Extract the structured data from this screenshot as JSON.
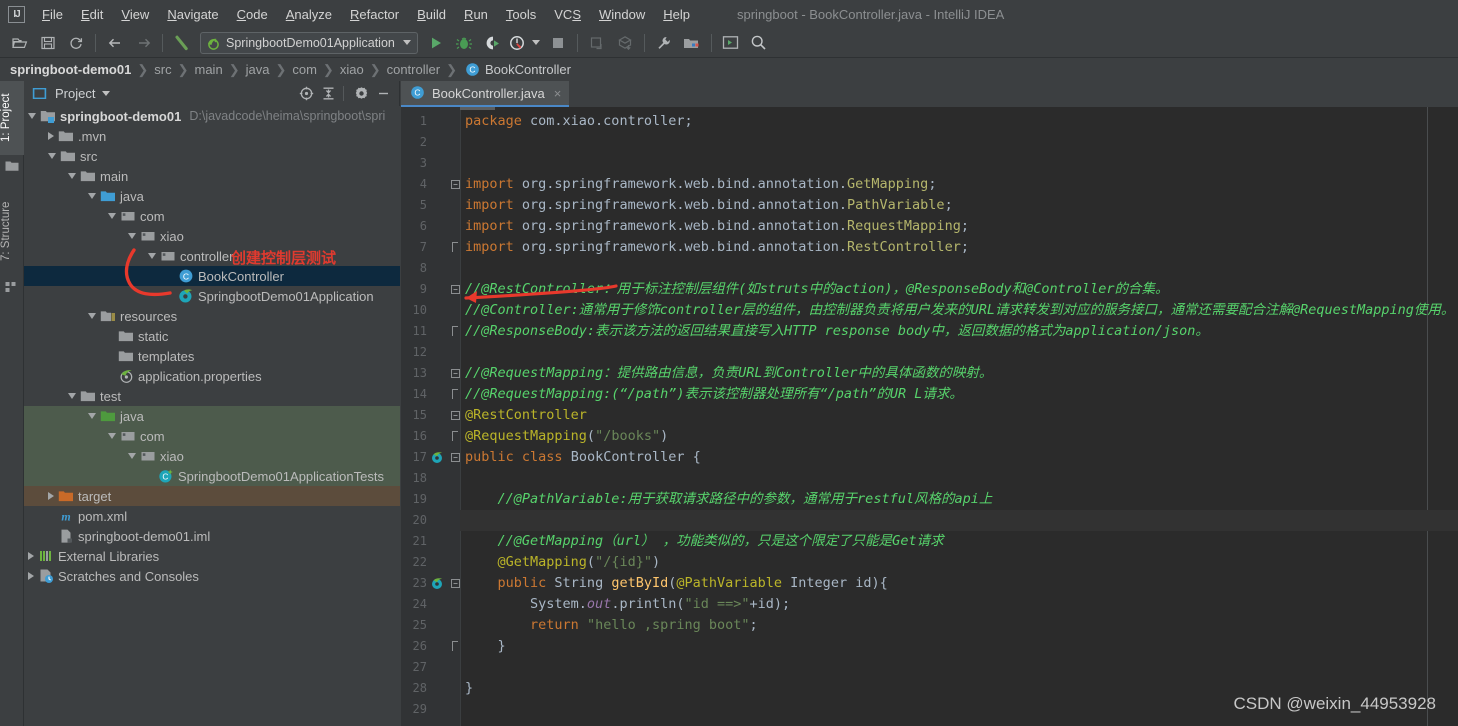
{
  "window": {
    "title": "springboot - BookController.java - IntelliJ IDEA",
    "logo": "IJ"
  },
  "menubar": {
    "items": [
      {
        "label": "File",
        "mnemonic": "F"
      },
      {
        "label": "Edit",
        "mnemonic": "E"
      },
      {
        "label": "View",
        "mnemonic": "V"
      },
      {
        "label": "Navigate",
        "mnemonic": "N"
      },
      {
        "label": "Code",
        "mnemonic": "C"
      },
      {
        "label": "Analyze",
        "mnemonic": "A"
      },
      {
        "label": "Refactor",
        "mnemonic": "R"
      },
      {
        "label": "Build",
        "mnemonic": "B"
      },
      {
        "label": "Run",
        "mnemonic": "R"
      },
      {
        "label": "Tools",
        "mnemonic": "T"
      },
      {
        "label": "VCS",
        "mnemonic": "S"
      },
      {
        "label": "Window",
        "mnemonic": "W"
      },
      {
        "label": "Help",
        "mnemonic": "H"
      }
    ]
  },
  "toolbar": {
    "run_config": "SpringbootDemo01Application",
    "icons": [
      "open-folder-icon",
      "save-all-icon",
      "sync-refresh-icon",
      "back-arrow-icon",
      "forward-arrow-icon",
      "build-hammer-icon",
      "run-icon",
      "debug-icon",
      "run-with-coverage-icon",
      "profiler-icon",
      "stop-icon",
      "update-project-icon",
      "push-commit-icon",
      "settings-wrench-icon",
      "project-structure-icon",
      "terminal-icon",
      "search-everywhere-icon"
    ]
  },
  "breadcrumb": {
    "root": "springboot-demo01",
    "segments": [
      "src",
      "main",
      "java",
      "com",
      "xiao",
      "controller"
    ],
    "leaf": "BookController",
    "leaf_icon": "class-icon"
  },
  "toolwindow_strip": {
    "tabs": [
      {
        "label": "1: Project",
        "active": true
      },
      {
        "label": "7: Structure",
        "active": false
      }
    ]
  },
  "project_panel": {
    "title": "Project",
    "header_icons": [
      "select-opened-file-icon",
      "collapse-all-icon",
      "gear-icon",
      "hide-icon"
    ],
    "tree": [
      {
        "depth": 0,
        "label": "springboot-demo01",
        "path": "D:\\javadcode\\heima\\springboot\\spri",
        "icon": "module-icon",
        "state": "expanded",
        "bold": true,
        "highlight": "none"
      },
      {
        "depth": 1,
        "label": ".mvn",
        "icon": "folder-icon",
        "state": "collapsed",
        "highlight": "none"
      },
      {
        "depth": 1,
        "label": "src",
        "icon": "folder-icon",
        "state": "expanded",
        "highlight": "none"
      },
      {
        "depth": 2,
        "label": "main",
        "icon": "folder-icon",
        "state": "expanded",
        "highlight": "none"
      },
      {
        "depth": 3,
        "label": "java",
        "icon": "source-root-icon",
        "state": "expanded",
        "highlight": "none"
      },
      {
        "depth": 4,
        "label": "com",
        "icon": "package-icon",
        "state": "expanded",
        "highlight": "none"
      },
      {
        "depth": 5,
        "label": "xiao",
        "icon": "package-icon",
        "state": "expanded",
        "highlight": "none"
      },
      {
        "depth": 6,
        "label": "controller",
        "icon": "package-icon",
        "state": "expanded",
        "highlight": "none"
      },
      {
        "depth": 7,
        "label": "BookController",
        "icon": "class-icon",
        "state": "leaf",
        "highlight": "selected"
      },
      {
        "depth": 7,
        "label": "SpringbootDemo01Application",
        "icon": "spring-class-icon",
        "state": "leaf",
        "highlight": "none"
      },
      {
        "depth": 3,
        "label": "resources",
        "icon": "resources-root-icon",
        "state": "expanded",
        "highlight": "none"
      },
      {
        "depth": 4,
        "label": "static",
        "icon": "folder-icon",
        "state": "leaf",
        "highlight": "none"
      },
      {
        "depth": 4,
        "label": "templates",
        "icon": "folder-icon",
        "state": "leaf",
        "highlight": "none"
      },
      {
        "depth": 4,
        "label": "application.properties",
        "icon": "spring-properties-icon",
        "state": "leaf",
        "highlight": "none"
      },
      {
        "depth": 2,
        "label": "test",
        "icon": "folder-icon",
        "state": "expanded",
        "highlight": "none"
      },
      {
        "depth": 3,
        "label": "java",
        "icon": "test-source-root-icon",
        "state": "expanded",
        "highlight": "green"
      },
      {
        "depth": 4,
        "label": "com",
        "icon": "package-icon",
        "state": "expanded",
        "highlight": "green"
      },
      {
        "depth": 5,
        "label": "xiao",
        "icon": "package-icon",
        "state": "expanded",
        "highlight": "green"
      },
      {
        "depth": 6,
        "label": "SpringbootDemo01ApplicationTests",
        "icon": "test-class-icon",
        "state": "leaf",
        "highlight": "green"
      },
      {
        "depth": 1,
        "label": "target",
        "icon": "excluded-folder-icon",
        "state": "collapsed",
        "highlight": "brown"
      },
      {
        "depth": 1,
        "label": "pom.xml",
        "icon": "maven-icon",
        "state": "leaf",
        "highlight": "none"
      },
      {
        "depth": 1,
        "label": "springboot-demo01.iml",
        "icon": "iml-file-icon",
        "state": "leaf",
        "highlight": "none"
      },
      {
        "depth": 0,
        "label": "External Libraries",
        "icon": "libraries-icon",
        "state": "collapsed",
        "highlight": "none"
      },
      {
        "depth": 0,
        "label": "Scratches and Consoles",
        "icon": "scratches-icon",
        "state": "collapsed",
        "highlight": "none"
      }
    ]
  },
  "editor": {
    "tab": {
      "label": "BookController.java",
      "icon": "class-icon",
      "close": "×"
    },
    "current_line": 20,
    "lines": [
      {
        "n": 1,
        "fold": "",
        "gmark": "",
        "html": "<span class=\"k\">package</span> com.xiao.controller;"
      },
      {
        "n": 2,
        "fold": "",
        "gmark": "",
        "html": ""
      },
      {
        "n": 3,
        "fold": "",
        "gmark": "",
        "html": ""
      },
      {
        "n": 4,
        "fold": "-",
        "gmark": "",
        "html": "<span class=\"k\">import</span> org.springframework.web.bind.annotation.<span class=\"cn\">GetMapping</span>;"
      },
      {
        "n": 5,
        "fold": "",
        "gmark": "",
        "html": "<span class=\"k\">import</span> org.springframework.web.bind.annotation.<span class=\"cn\">PathVariable</span>;"
      },
      {
        "n": 6,
        "fold": "",
        "gmark": "",
        "html": "<span class=\"k\">import</span> org.springframework.web.bind.annotation.<span class=\"cn\">RequestMapping</span>;"
      },
      {
        "n": 7,
        "fold": "v",
        "gmark": "",
        "html": "<span class=\"k\">import</span> org.springframework.web.bind.annotation.<span class=\"cn\">RestController</span>;"
      },
      {
        "n": 8,
        "fold": "",
        "gmark": "",
        "html": ""
      },
      {
        "n": 9,
        "fold": "-",
        "gmark": "",
        "html": "<span class=\"cm\">//@RestController：用于标注控制层组件(如struts中的action)，@ResponseBody和@Controller的合集。</span>"
      },
      {
        "n": 10,
        "fold": "",
        "gmark": "",
        "html": "<span class=\"cm\">//@Controller:通常用于修饰controller层的组件，由控制器负责将用户发来的URL请求转发到对应的服务接口，通常还需要配合注解@RequestMapping使用。</span>"
      },
      {
        "n": 11,
        "fold": "v",
        "gmark": "",
        "html": "<span class=\"cm\">//@ResponseBody:表示该方法的返回结果直接写入HTTP response body中，返回数据的格式为application/json。</span>"
      },
      {
        "n": 12,
        "fold": "",
        "gmark": "",
        "html": ""
      },
      {
        "n": 13,
        "fold": "-",
        "gmark": "",
        "html": "<span class=\"cm\">//@RequestMapping：提供路由信息，负责URL到Controller中的具体函数的映射。</span>"
      },
      {
        "n": 14,
        "fold": "v",
        "gmark": "",
        "html": "<span class=\"cm\">//@RequestMapping:(“/path”)表示该控制器处理所有“/path”的UR L请求。</span>"
      },
      {
        "n": 15,
        "fold": "-",
        "gmark": "",
        "html": "<span class=\"an\">@RestController</span>"
      },
      {
        "n": 16,
        "fold": "v",
        "gmark": "",
        "html": "<span class=\"an\">@RequestMapping</span>(<span class=\"st\">\"/books\"</span>)"
      },
      {
        "n": 17,
        "fold": "-",
        "gmark": "spring-bean-icon",
        "html": "<span class=\"k\">public</span> <span class=\"k\">class</span> <span class=\"pn\">BookController</span> {"
      },
      {
        "n": 18,
        "fold": "",
        "gmark": "",
        "html": ""
      },
      {
        "n": 19,
        "fold": "",
        "gmark": "",
        "html": "    <span class=\"cm\">//@PathVariable:用于获取请求路径中的参数，通常用于restful风格的api上</span>"
      },
      {
        "n": 20,
        "fold": "",
        "gmark": "",
        "html": ""
      },
      {
        "n": 21,
        "fold": "",
        "gmark": "",
        "html": "    <span class=\"cm\">//@GetMapping（url） ，功能类似的，只是这个限定了只能是Get请求</span>"
      },
      {
        "n": 22,
        "fold": "",
        "gmark": "",
        "html": "    <span class=\"an\">@GetMapping</span>(<span class=\"st\">\"/{id}\"</span>)"
      },
      {
        "n": 23,
        "fold": "-",
        "gmark": "request-mapping-icon",
        "html": "    <span class=\"k\">public</span> String <span class=\"fd\">getById</span>(<span class=\"an\">@PathVariable</span> Integer id){"
      },
      {
        "n": 24,
        "fold": "",
        "gmark": "",
        "html": "        System.<span class=\"fi\">out</span>.println(<span class=\"st\">\"id ==&gt;\"</span>+id);"
      },
      {
        "n": 25,
        "fold": "",
        "gmark": "",
        "html": "        <span class=\"k\">return</span> <span class=\"st\">\"hello ,spring boot\"</span>;"
      },
      {
        "n": 26,
        "fold": "v",
        "gmark": "",
        "html": "    }"
      },
      {
        "n": 27,
        "fold": "",
        "gmark": "",
        "html": ""
      },
      {
        "n": 28,
        "fold": "",
        "gmark": "",
        "html": "}"
      },
      {
        "n": 29,
        "fold": "",
        "gmark": "",
        "html": ""
      }
    ]
  },
  "annotations": {
    "note_text": "创建控制层测试",
    "arrow_color": "#e8392c"
  },
  "watermark": {
    "text": "CSDN @weixin_44953928"
  },
  "colors": {
    "chrome_bg": "#3c3f41",
    "editor_bg": "#2b2b2b",
    "gutter_bg": "#313335",
    "selection_blue": "#0d293e",
    "tab_underline": "#4a88c7",
    "accent_red": "#e8392c",
    "comment_green": "#57d36c",
    "keyword_orange": "#cc7832",
    "string_green": "#6a8759",
    "annotation_yellow": "#bbb529"
  }
}
